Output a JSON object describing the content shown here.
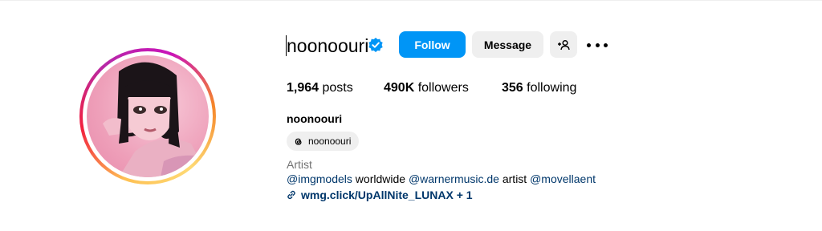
{
  "profile": {
    "username": "noonoouri",
    "full_name": "noonoouri",
    "verified": true,
    "category": "Artist",
    "threads_handle": "noonoouri"
  },
  "actions": {
    "follow_label": "Follow",
    "message_label": "Message"
  },
  "stats": {
    "posts_count": "1,964",
    "posts_label": "posts",
    "followers_count": "490K",
    "followers_label": "followers",
    "following_count": "356",
    "following_label": "following"
  },
  "bio": {
    "mention1": "@imgmodels",
    "text1": " worldwide ",
    "mention2": "@warnermusic.de",
    "text2": " artist ",
    "mention3": "@movellaent"
  },
  "link": {
    "text": "wmg.click/UpAllNite_LUNAX + 1"
  },
  "colors": {
    "accent": "#0095f6",
    "link": "#00376b",
    "secondary_bg": "#efefef",
    "muted_text": "#737373"
  },
  "icons": [
    "verified-badge-icon",
    "add-user-icon",
    "more-options-icon",
    "threads-icon",
    "link-icon"
  ]
}
